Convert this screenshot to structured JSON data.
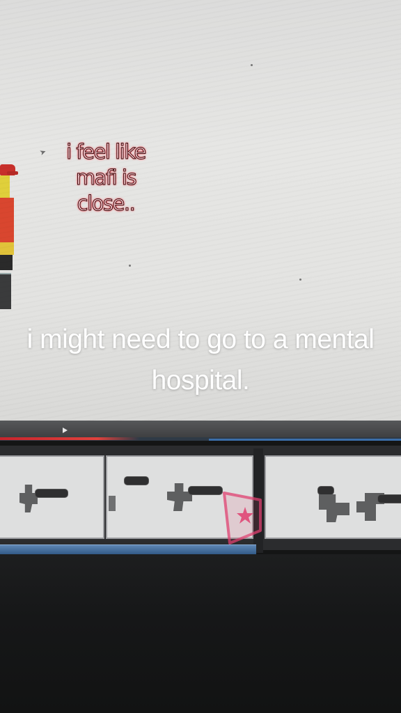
{
  "chat_bubble": {
    "text": "i feel like\nmafi is\nclose.."
  },
  "caption": {
    "text": "i might need to go to a mental hospital."
  },
  "icons": [
    "cursor-arrow-icon",
    "play-icon",
    "star-icon"
  ],
  "colors": {
    "chat_fill": "#f7c7cc",
    "chat_glow": "#ff4d5a",
    "progress": "#c8242c",
    "accent_blue": "#3b6ea8"
  }
}
